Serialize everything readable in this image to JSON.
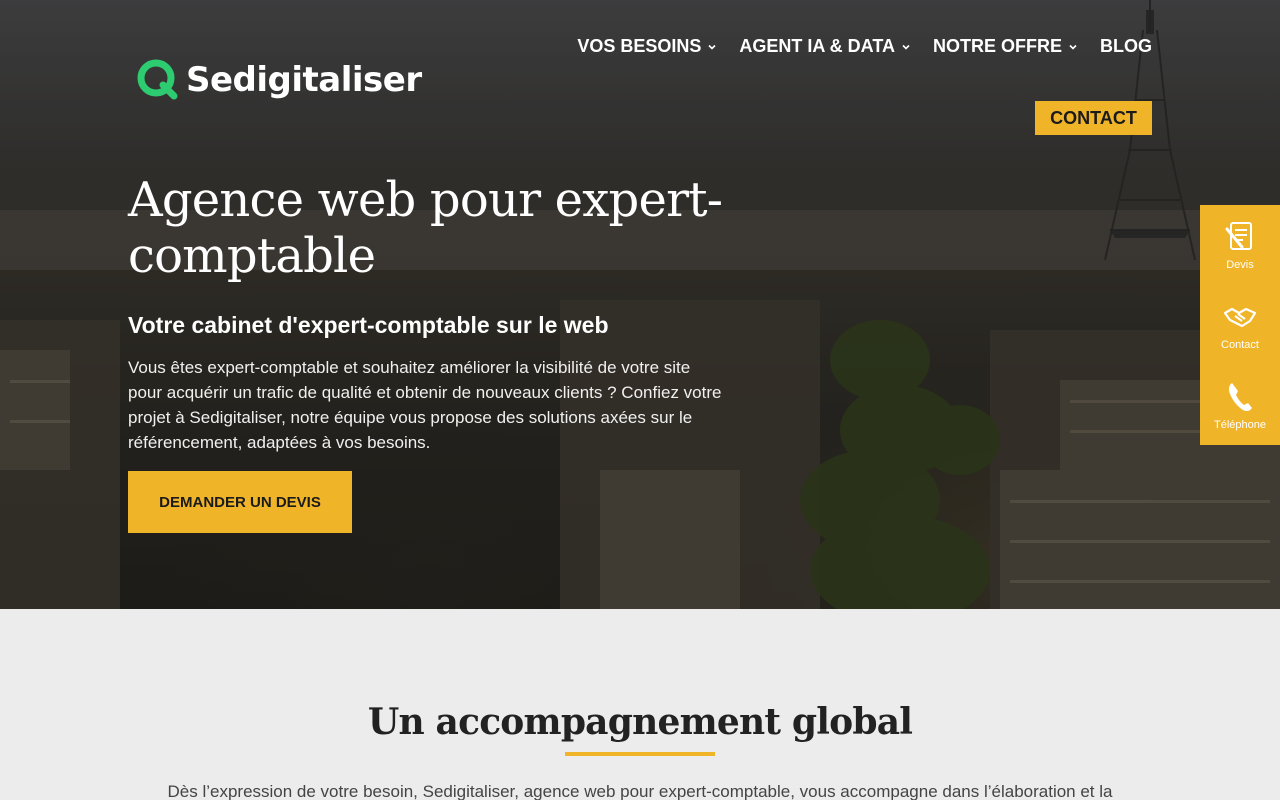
{
  "brand": {
    "name": "Sedigitaliser",
    "accent": "#f0b429",
    "logo_green": "#2ecc71"
  },
  "nav": {
    "items": [
      {
        "label": "VOS BESOINS",
        "has_dropdown": true
      },
      {
        "label": "AGENT IA & DATA",
        "has_dropdown": true
      },
      {
        "label": "NOTRE OFFRE",
        "has_dropdown": true
      },
      {
        "label": "BLOG",
        "has_dropdown": false
      }
    ],
    "contact_label": "CONTACT"
  },
  "hero": {
    "title": "Agence web pour expert-comptable",
    "subtitle": "Votre cabinet d'expert-comptable sur le web",
    "text": "Vous êtes expert-comptable et souhaitez améliorer la visibilité de votre site pour acquérir un trafic de qualité et obtenir de nouveaux clients ? Confiez votre projet à Sedigitaliser, notre équipe vous propose des solutions axées sur le référencement, adaptées à vos besoins.",
    "cta_label": "DEMANDER UN DEVIS"
  },
  "sidebar": {
    "items": [
      {
        "label": "Devis",
        "icon": "quote-form-icon"
      },
      {
        "label": "Contact",
        "icon": "handshake-icon"
      },
      {
        "label": "Téléphone",
        "icon": "phone-icon"
      }
    ]
  },
  "section": {
    "title": "Un accompagnement global",
    "text": "Dès l’expression de votre besoin, Sedigitaliser, agence web pour expert-comptable, vous accompagne dans l’élaboration et la"
  }
}
